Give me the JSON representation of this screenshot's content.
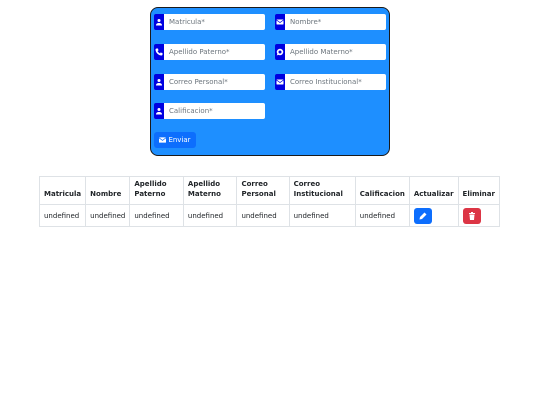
{
  "form": {
    "fields": {
      "matricula": {
        "placeholder": "Matricula*",
        "value": "",
        "icon": "person-icon"
      },
      "nombre": {
        "placeholder": "Nombre*",
        "value": "",
        "icon": "envelope-icon"
      },
      "apellido_paterno": {
        "placeholder": "Apellido Paterno*",
        "value": "",
        "icon": "phone-icon"
      },
      "apellido_materno": {
        "placeholder": "Apellido Materno*",
        "value": "",
        "icon": "whatsapp-icon"
      },
      "correo_personal": {
        "placeholder": "Correo Personal*",
        "value": "",
        "icon": "person-icon"
      },
      "correo_institucional": {
        "placeholder": "Correo Institucional*",
        "value": "",
        "icon": "envelope-icon"
      },
      "calificacion": {
        "placeholder": "Calificacion*",
        "value": "",
        "icon": "person-icon"
      }
    },
    "submit_label": "Enviar"
  },
  "table": {
    "headers": {
      "matricula": "Matricula",
      "nombre": "Nombre",
      "apellido_paterno": "Apellido Paterno",
      "apellido_materno": "Apellido Materno",
      "correo_personal": "Correo Personal",
      "correo_institucional": "Correo Institucional",
      "calificacion": "Calificacion",
      "actualizar": "Actualizar",
      "eliminar": "Eliminar"
    },
    "rows": [
      {
        "matricula": "undefined",
        "nombre": "undefined",
        "apellido_paterno": "undefined",
        "apellido_materno": "undefined",
        "correo_personal": "undefined",
        "correo_institucional": "undefined",
        "calificacion": "undefined"
      }
    ]
  },
  "colors": {
    "form_background": "#1e8fff",
    "icon_background": "#0000e0",
    "primary": "#0d6efd",
    "danger": "#dc3545"
  }
}
